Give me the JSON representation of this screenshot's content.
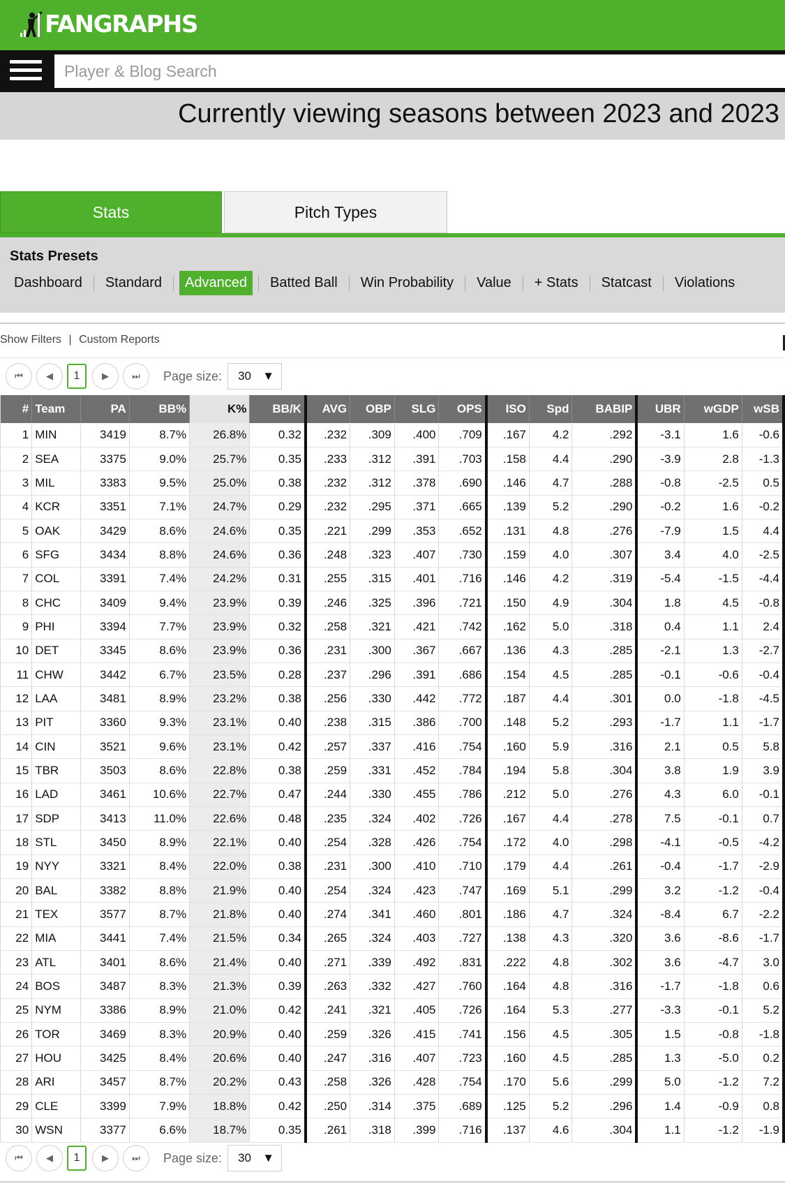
{
  "brand": {
    "name": "FANGRAPHS",
    "color": "#4fb12b"
  },
  "search": {
    "placeholder": "Player & Blog Search"
  },
  "banner": {
    "text": "Currently viewing seasons between 2023 and 2023"
  },
  "tabs": [
    {
      "label": "Stats",
      "active": true
    },
    {
      "label": "Pitch Types",
      "active": false
    }
  ],
  "presets": {
    "title": "Stats Presets",
    "items": [
      {
        "label": "Dashboard",
        "active": false
      },
      {
        "label": "Standard",
        "active": false
      },
      {
        "label": "Advanced",
        "active": true
      },
      {
        "label": "Batted Ball",
        "active": false
      },
      {
        "label": "Win Probability",
        "active": false
      },
      {
        "label": "Value",
        "active": false
      },
      {
        "label": "+ Stats",
        "active": false
      },
      {
        "label": "Statcast",
        "active": false
      },
      {
        "label": "Violations",
        "active": false
      }
    ]
  },
  "filters": {
    "show_filters": "Show Filters",
    "separator": "|",
    "custom_reports": "Custom Reports"
  },
  "pager": {
    "current_page": "1",
    "page_size_label": "Page size:",
    "page_size": "30"
  },
  "table": {
    "sorted_column": "K%",
    "columns": [
      "#",
      "Team",
      "PA",
      "BB%",
      "K%",
      "BB/K",
      "AVG",
      "OBP",
      "SLG",
      "OPS",
      "ISO",
      "Spd",
      "BABIP",
      "UBR",
      "wGDP",
      "wSB"
    ],
    "rows": [
      [
        "1",
        "MIN",
        "3419",
        "8.7%",
        "26.8%",
        "0.32",
        ".232",
        ".309",
        ".400",
        ".709",
        ".167",
        "4.2",
        ".292",
        "-3.1",
        "1.6",
        "-0.6"
      ],
      [
        "2",
        "SEA",
        "3375",
        "9.0%",
        "25.7%",
        "0.35",
        ".233",
        ".312",
        ".391",
        ".703",
        ".158",
        "4.4",
        ".290",
        "-3.9",
        "2.8",
        "-1.3"
      ],
      [
        "3",
        "MIL",
        "3383",
        "9.5%",
        "25.0%",
        "0.38",
        ".232",
        ".312",
        ".378",
        ".690",
        ".146",
        "4.7",
        ".288",
        "-0.8",
        "-2.5",
        "0.5"
      ],
      [
        "4",
        "KCR",
        "3351",
        "7.1%",
        "24.7%",
        "0.29",
        ".232",
        ".295",
        ".371",
        ".665",
        ".139",
        "5.2",
        ".290",
        "-0.2",
        "1.6",
        "-0.2"
      ],
      [
        "5",
        "OAK",
        "3429",
        "8.6%",
        "24.6%",
        "0.35",
        ".221",
        ".299",
        ".353",
        ".652",
        ".131",
        "4.8",
        ".276",
        "-7.9",
        "1.5",
        "4.4"
      ],
      [
        "6",
        "SFG",
        "3434",
        "8.8%",
        "24.6%",
        "0.36",
        ".248",
        ".323",
        ".407",
        ".730",
        ".159",
        "4.0",
        ".307",
        "3.4",
        "4.0",
        "-2.5"
      ],
      [
        "7",
        "COL",
        "3391",
        "7.4%",
        "24.2%",
        "0.31",
        ".255",
        ".315",
        ".401",
        ".716",
        ".146",
        "4.2",
        ".319",
        "-5.4",
        "-1.5",
        "-4.4"
      ],
      [
        "8",
        "CHC",
        "3409",
        "9.4%",
        "23.9%",
        "0.39",
        ".246",
        ".325",
        ".396",
        ".721",
        ".150",
        "4.9",
        ".304",
        "1.8",
        "4.5",
        "-0.8"
      ],
      [
        "9",
        "PHI",
        "3394",
        "7.7%",
        "23.9%",
        "0.32",
        ".258",
        ".321",
        ".421",
        ".742",
        ".162",
        "5.0",
        ".318",
        "0.4",
        "1.1",
        "2.4"
      ],
      [
        "10",
        "DET",
        "3345",
        "8.6%",
        "23.9%",
        "0.36",
        ".231",
        ".300",
        ".367",
        ".667",
        ".136",
        "4.3",
        ".285",
        "-2.1",
        "1.3",
        "-2.7"
      ],
      [
        "11",
        "CHW",
        "3442",
        "6.7%",
        "23.5%",
        "0.28",
        ".237",
        ".296",
        ".391",
        ".686",
        ".154",
        "4.5",
        ".285",
        "-0.1",
        "-0.6",
        "-0.4"
      ],
      [
        "12",
        "LAA",
        "3481",
        "8.9%",
        "23.2%",
        "0.38",
        ".256",
        ".330",
        ".442",
        ".772",
        ".187",
        "4.4",
        ".301",
        "0.0",
        "-1.8",
        "-4.5"
      ],
      [
        "13",
        "PIT",
        "3360",
        "9.3%",
        "23.1%",
        "0.40",
        ".238",
        ".315",
        ".386",
        ".700",
        ".148",
        "5.2",
        ".293",
        "-1.7",
        "1.1",
        "-1.7"
      ],
      [
        "14",
        "CIN",
        "3521",
        "9.6%",
        "23.1%",
        "0.42",
        ".257",
        ".337",
        ".416",
        ".754",
        ".160",
        "5.9",
        ".316",
        "2.1",
        "0.5",
        "5.8"
      ],
      [
        "15",
        "TBR",
        "3503",
        "8.6%",
        "22.8%",
        "0.38",
        ".259",
        ".331",
        ".452",
        ".784",
        ".194",
        "5.8",
        ".304",
        "3.8",
        "1.9",
        "3.9"
      ],
      [
        "16",
        "LAD",
        "3461",
        "10.6%",
        "22.7%",
        "0.47",
        ".244",
        ".330",
        ".455",
        ".786",
        ".212",
        "5.0",
        ".276",
        "4.3",
        "6.0",
        "-0.1"
      ],
      [
        "17",
        "SDP",
        "3413",
        "11.0%",
        "22.6%",
        "0.48",
        ".235",
        ".324",
        ".402",
        ".726",
        ".167",
        "4.4",
        ".278",
        "7.5",
        "-0.1",
        "0.7"
      ],
      [
        "18",
        "STL",
        "3450",
        "8.9%",
        "22.1%",
        "0.40",
        ".254",
        ".328",
        ".426",
        ".754",
        ".172",
        "4.0",
        ".298",
        "-4.1",
        "-0.5",
        "-4.2"
      ],
      [
        "19",
        "NYY",
        "3321",
        "8.4%",
        "22.0%",
        "0.38",
        ".231",
        ".300",
        ".410",
        ".710",
        ".179",
        "4.4",
        ".261",
        "-0.4",
        "-1.7",
        "-2.9"
      ],
      [
        "20",
        "BAL",
        "3382",
        "8.8%",
        "21.9%",
        "0.40",
        ".254",
        ".324",
        ".423",
        ".747",
        ".169",
        "5.1",
        ".299",
        "3.2",
        "-1.2",
        "-0.4"
      ],
      [
        "21",
        "TEX",
        "3577",
        "8.7%",
        "21.8%",
        "0.40",
        ".274",
        ".341",
        ".460",
        ".801",
        ".186",
        "4.7",
        ".324",
        "-8.4",
        "6.7",
        "-2.2"
      ],
      [
        "22",
        "MIA",
        "3441",
        "7.4%",
        "21.5%",
        "0.34",
        ".265",
        ".324",
        ".403",
        ".727",
        ".138",
        "4.3",
        ".320",
        "3.6",
        "-8.6",
        "-1.7"
      ],
      [
        "23",
        "ATL",
        "3401",
        "8.6%",
        "21.4%",
        "0.40",
        ".271",
        ".339",
        ".492",
        ".831",
        ".222",
        "4.8",
        ".302",
        "3.6",
        "-4.7",
        "3.0"
      ],
      [
        "24",
        "BOS",
        "3487",
        "8.3%",
        "21.3%",
        "0.39",
        ".263",
        ".332",
        ".427",
        ".760",
        ".164",
        "4.8",
        ".316",
        "-1.7",
        "-1.8",
        "0.6"
      ],
      [
        "25",
        "NYM",
        "3386",
        "8.9%",
        "21.0%",
        "0.42",
        ".241",
        ".321",
        ".405",
        ".726",
        ".164",
        "5.3",
        ".277",
        "-3.3",
        "-0.1",
        "5.2"
      ],
      [
        "26",
        "TOR",
        "3469",
        "8.3%",
        "20.9%",
        "0.40",
        ".259",
        ".326",
        ".415",
        ".741",
        ".156",
        "4.5",
        ".305",
        "1.5",
        "-0.8",
        "-1.8"
      ],
      [
        "27",
        "HOU",
        "3425",
        "8.4%",
        "20.6%",
        "0.40",
        ".247",
        ".316",
        ".407",
        ".723",
        ".160",
        "4.5",
        ".285",
        "1.3",
        "-5.0",
        "0.2"
      ],
      [
        "28",
        "ARI",
        "3457",
        "8.7%",
        "20.2%",
        "0.43",
        ".258",
        ".326",
        ".428",
        ".754",
        ".170",
        "5.6",
        ".299",
        "5.0",
        "-1.2",
        "7.2"
      ],
      [
        "29",
        "CLE",
        "3399",
        "7.9%",
        "18.8%",
        "0.42",
        ".250",
        ".314",
        ".375",
        ".689",
        ".125",
        "5.2",
        ".296",
        "1.4",
        "-0.9",
        "0.8"
      ],
      [
        "30",
        "WSN",
        "3377",
        "6.6%",
        "18.7%",
        "0.35",
        ".261",
        ".318",
        ".399",
        ".716",
        ".137",
        "4.6",
        ".304",
        "1.1",
        "-1.2",
        "-1.9"
      ]
    ]
  }
}
